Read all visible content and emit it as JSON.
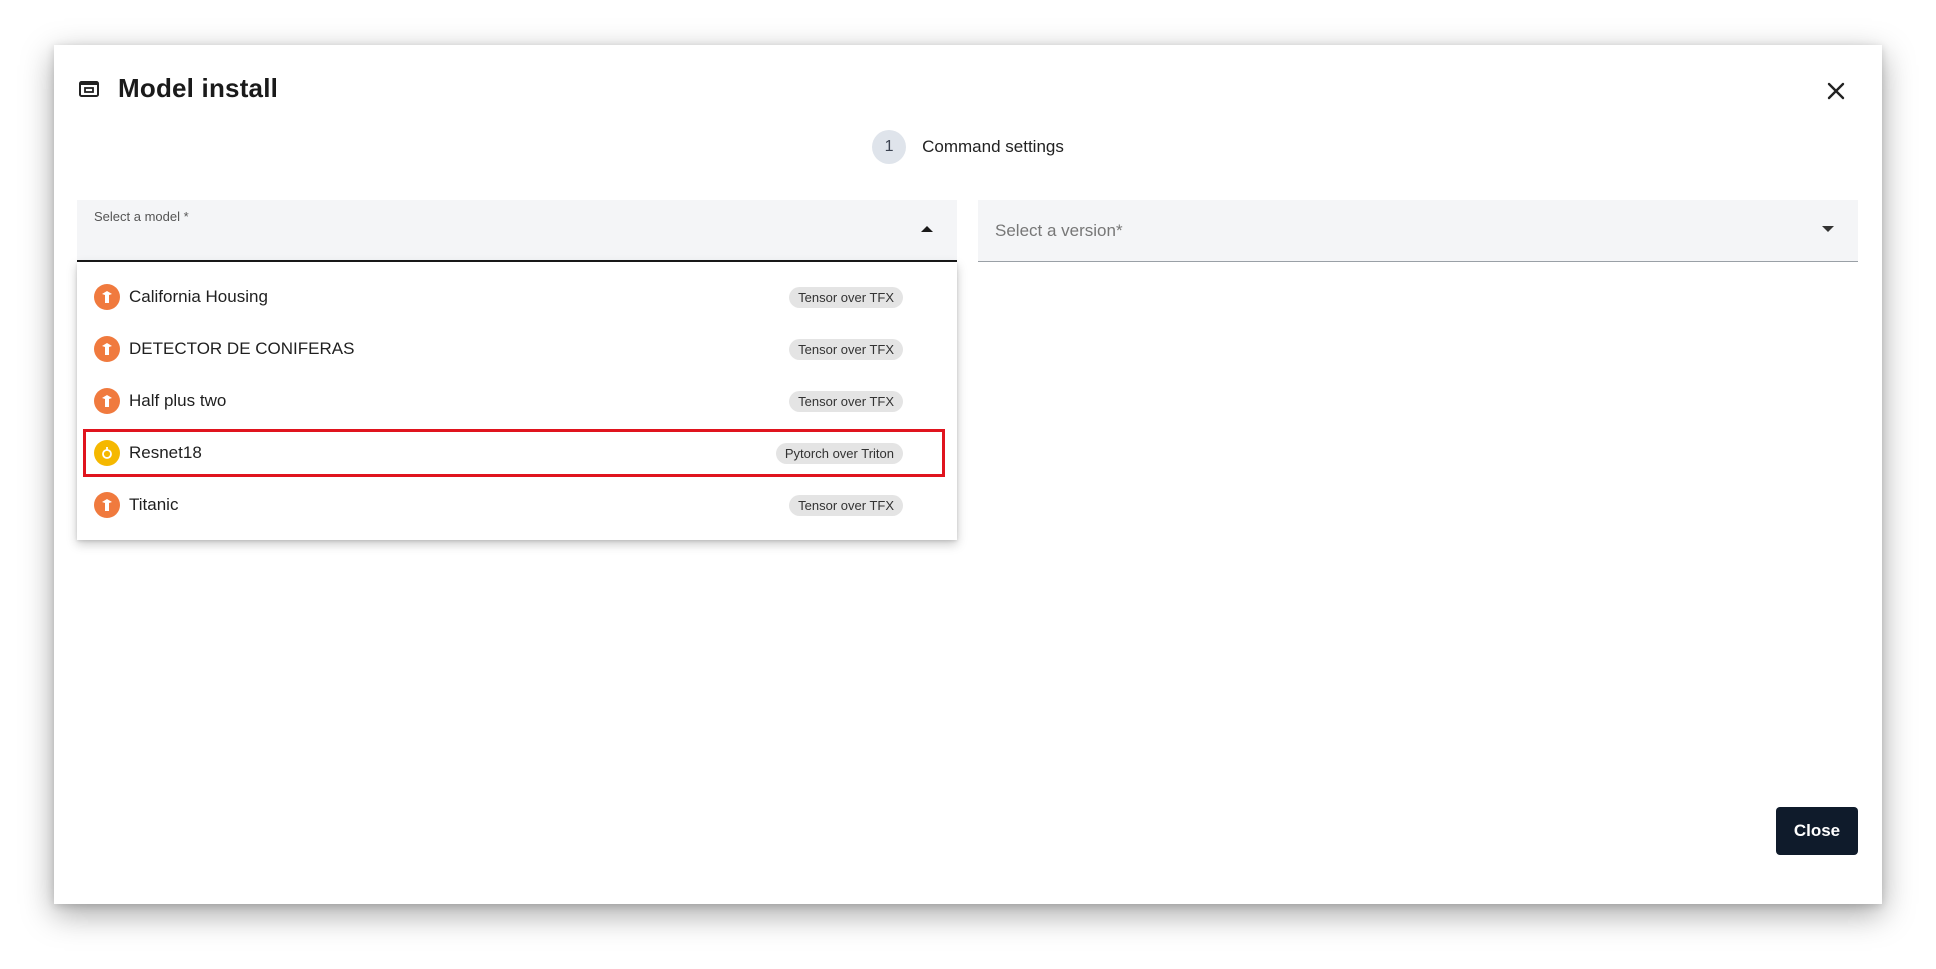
{
  "dialog": {
    "title": "Model install",
    "close_button_label": "Close"
  },
  "stepper": {
    "step_number": "1",
    "step_label": "Command settings"
  },
  "model_select": {
    "label": "Select a model *",
    "expanded": true,
    "options": [
      {
        "name": "California Housing",
        "badge": "Tensor over TFX",
        "icon": "tensorflow-icon",
        "icon_color": "#f07a3e"
      },
      {
        "name": "DETECTOR DE CONIFERAS",
        "badge": "Tensor over TFX",
        "icon": "tensorflow-icon",
        "icon_color": "#f07a3e"
      },
      {
        "name": "Half plus two",
        "badge": "Tensor over TFX",
        "icon": "tensorflow-icon",
        "icon_color": "#f07a3e"
      },
      {
        "name": "Resnet18",
        "badge": "Pytorch over Triton",
        "icon": "pytorch-icon",
        "icon_color": "#f5b800",
        "highlighted": true
      },
      {
        "name": "Titanic",
        "badge": "Tensor over TFX",
        "icon": "tensorflow-icon",
        "icon_color": "#f07a3e"
      }
    ]
  },
  "version_select": {
    "placeholder": "Select a version*"
  },
  "colors": {
    "highlight_border": "#e0141e",
    "primary_button": "#0f1b2b"
  }
}
